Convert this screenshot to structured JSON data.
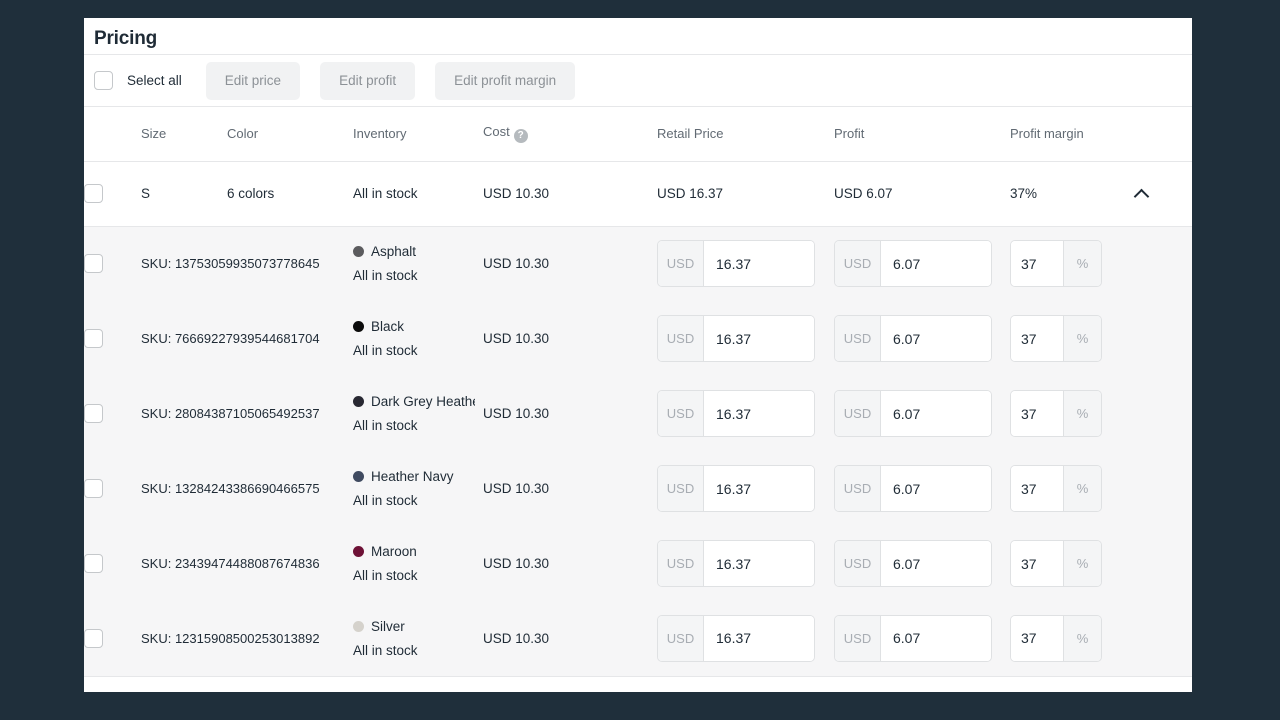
{
  "page": {
    "title": "Pricing",
    "background_color": "#1f2f3b",
    "card_color": "#ffffff"
  },
  "bulk_bar": {
    "select_all_label": "Select all",
    "buttons": [
      {
        "label": "Edit price",
        "disabled": true
      },
      {
        "label": "Edit profit",
        "disabled": true
      },
      {
        "label": "Edit profit margin",
        "disabled": true
      }
    ]
  },
  "table": {
    "columns": [
      "Size",
      "Color",
      "Inventory",
      "Cost",
      "Retail Price",
      "Profit",
      "Profit margin"
    ],
    "cost_help_icon": "?",
    "parent_row": {
      "size": "S",
      "color": "6 colors",
      "inventory": "All in stock",
      "cost": "USD 10.30",
      "retail_price": "USD 16.37",
      "profit": "USD 6.07",
      "profit_margin": "37%",
      "expanded": true
    },
    "currency_prefix": "USD",
    "percent_suffix": "%",
    "variants": [
      {
        "sku": "SKU: 13753059935073778645",
        "color_name": "Asphalt",
        "swatch_color": "#5b5b5e",
        "inventory": "All in stock",
        "cost": "USD 10.30",
        "retail_price": "16.37",
        "profit": "6.07",
        "profit_margin": "37"
      },
      {
        "sku": "SKU: 76669227939544681704",
        "color_name": "Black",
        "swatch_color": "#0b0b0b",
        "inventory": "All in stock",
        "cost": "USD 10.30",
        "retail_price": "16.37",
        "profit": "6.07",
        "profit_margin": "37"
      },
      {
        "sku": "SKU: 28084387105065492537",
        "color_name": "Dark Grey Heather",
        "swatch_color": "#282832",
        "inventory": "All in stock",
        "cost": "USD 10.30",
        "retail_price": "16.37",
        "profit": "6.07",
        "profit_margin": "37"
      },
      {
        "sku": "SKU: 13284243386690466575",
        "color_name": "Heather Navy",
        "swatch_color": "#3f4a60",
        "inventory": "All in stock",
        "cost": "USD 10.30",
        "retail_price": "16.37",
        "profit": "6.07",
        "profit_margin": "37"
      },
      {
        "sku": "SKU: 23439474488087674836",
        "color_name": "Maroon",
        "swatch_color": "#6d1136",
        "inventory": "All in stock",
        "cost": "USD 10.30",
        "retail_price": "16.37",
        "profit": "6.07",
        "profit_margin": "37"
      },
      {
        "sku": "SKU: 12315908500253013892",
        "color_name": "Silver",
        "swatch_color": "#d5d2cc",
        "inventory": "All in stock",
        "cost": "USD 10.30",
        "retail_price": "16.37",
        "profit": "6.07",
        "profit_margin": "37"
      }
    ]
  }
}
